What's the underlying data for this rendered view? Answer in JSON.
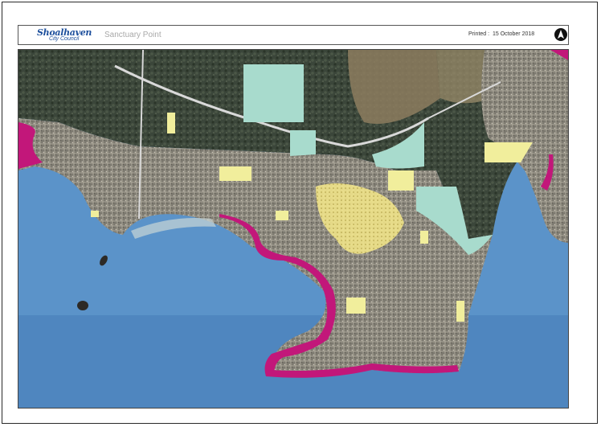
{
  "header": {
    "logo_main": "Shoalhaven",
    "logo_sub": "City Council",
    "place_name": "Sanctuary Point",
    "printed_label": "Printed :",
    "printed_date": "15 October 2018"
  },
  "icons": {
    "north_arrow": "north-arrow-icon"
  },
  "colors": {
    "water": "#5b93c9",
    "land": "#3e4a3b",
    "zone_yellow": "#f1ee9c",
    "zone_green": "#a8dbcd",
    "zone_magenta": "#c2177a",
    "road": "#d9d9d9"
  }
}
